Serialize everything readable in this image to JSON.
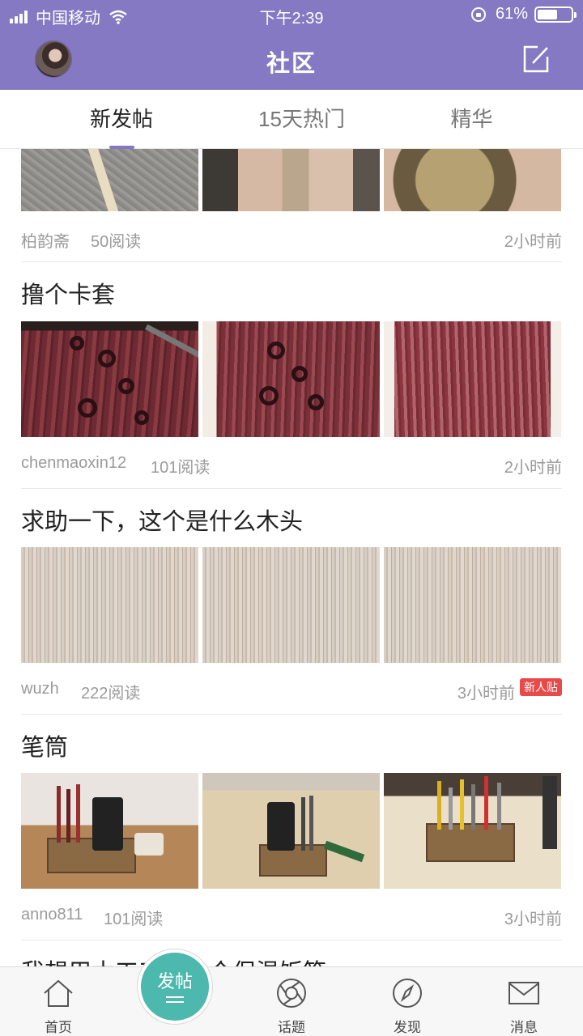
{
  "status_bar": {
    "carrier": "中国移动",
    "time": "下午2:39",
    "battery_percent": "61%",
    "battery_level": 0.61
  },
  "header": {
    "title": "社区",
    "avatar_icon": "user-avatar",
    "compose_icon": "edit-icon"
  },
  "tabs": [
    {
      "label": "新发帖",
      "active": true
    },
    {
      "label": "15天热门",
      "active": false
    },
    {
      "label": "精华",
      "active": false
    }
  ],
  "posts": [
    {
      "title": "",
      "author": "柏韵斋",
      "reads": "50阅读",
      "time": "2小时前",
      "badge": ""
    },
    {
      "title": "撸个卡套",
      "author": "chenmaoxin12",
      "reads": "101阅读",
      "time": "2小时前",
      "badge": ""
    },
    {
      "title": "求助一下，这个是什么木头",
      "author": "wuzh",
      "reads": "222阅读",
      "time": "3小时前",
      "badge": "新人贴"
    },
    {
      "title": "笔筒",
      "author": "anno811",
      "reads": "101阅读",
      "time": "3小时前",
      "badge": ""
    }
  ],
  "partial_post_title": "我想用木工工做一个保温饭箱",
  "bottom_nav": {
    "home": "首页",
    "post_button": "发帖",
    "topics": "话题",
    "discover": "发现",
    "messages": "消息"
  },
  "colors": {
    "header_bg": "#8479c2",
    "fab_bg": "#4db8ad",
    "badge_bg": "#e84a4a"
  }
}
